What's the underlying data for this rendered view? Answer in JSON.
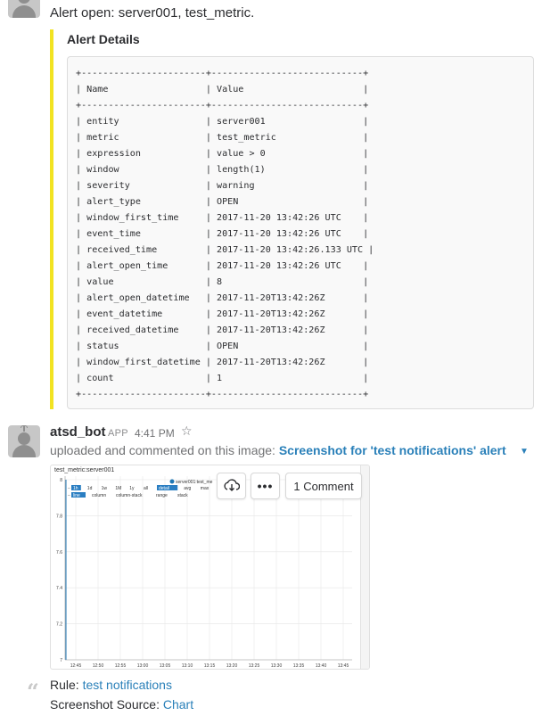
{
  "message1": {
    "text": "Alert open: server001, test_metric.",
    "attachment_color": "#f2e322",
    "attachment_title": "Alert Details",
    "table_text": "+-----------------------+----------------------------+\n| Name                  | Value                      |\n+-----------------------+----------------------------+\n| entity                | server001                  |\n| metric                | test_metric                |\n| expression            | value > 0                  |\n| window                | length(1)                  |\n| severity              | warning                    |\n| alert_type            | OPEN                       |\n| window_first_time     | 2017-11-20 13:42:26 UTC    |\n| event_time            | 2017-11-20 13:42:26 UTC    |\n| received_time         | 2017-11-20 13:42:26.133 UTC |\n| alert_open_time       | 2017-11-20 13:42:26 UTC    |\n| value                 | 8                          |\n| alert_open_datetime   | 2017-11-20T13:42:26Z       |\n| event_datetime        | 2017-11-20T13:42:26Z       |\n| received_datetime     | 2017-11-20T13:42:26Z       |\n| status                | OPEN                       |\n| window_first_datetime | 2017-11-20T13:42:26Z       |\n| count                 | 1                          |\n+-----------------------+----------------------------+"
  },
  "message2": {
    "author": "atsd_bot",
    "badge": "APP",
    "time": "4:41 PM",
    "star_icon": "star-icon",
    "upload_prefix": "uploaded and commented on this image:",
    "upload_link": "Screenshot for 'test notifications' alert",
    "caret_icon": "caret-down-icon",
    "image_actions": {
      "download_icon": "download-icon",
      "more_icon": "more-icon",
      "more_label": "•••",
      "comment_label": "1 Comment"
    },
    "rule_label": "Rule:",
    "rule_link": "test notifications",
    "source_label": "Screenshot Source:",
    "source_link": "Chart",
    "link_color": "#2a80b9"
  },
  "chart_data": {
    "type": "line",
    "title": "test_metric:server001",
    "legend": "server001:test_me",
    "periods": [
      "1h",
      "1d",
      "1w",
      "1M",
      "1y",
      "all"
    ],
    "statistics": [
      "detail",
      "avg",
      "max",
      "m"
    ],
    "modes": [
      "line",
      "column",
      "column-stack",
      "range",
      "stack"
    ],
    "selected_period": "1h",
    "selected_statistic": "detail",
    "selected_mode": "line",
    "y_ticks": [
      7,
      7.2,
      7.4,
      7.6,
      7.8,
      8
    ],
    "ylim": [
      7,
      8
    ],
    "x_ticks": [
      "12:45",
      "12:50",
      "12:55",
      "13:00",
      "13:05",
      "13:10",
      "13:15",
      "13:20",
      "13:25",
      "13:30",
      "13:35",
      "13:40",
      "13:45"
    ],
    "series": [
      {
        "name": "server001:test_me",
        "color": "#1f77b4"
      }
    ],
    "grid": true
  }
}
